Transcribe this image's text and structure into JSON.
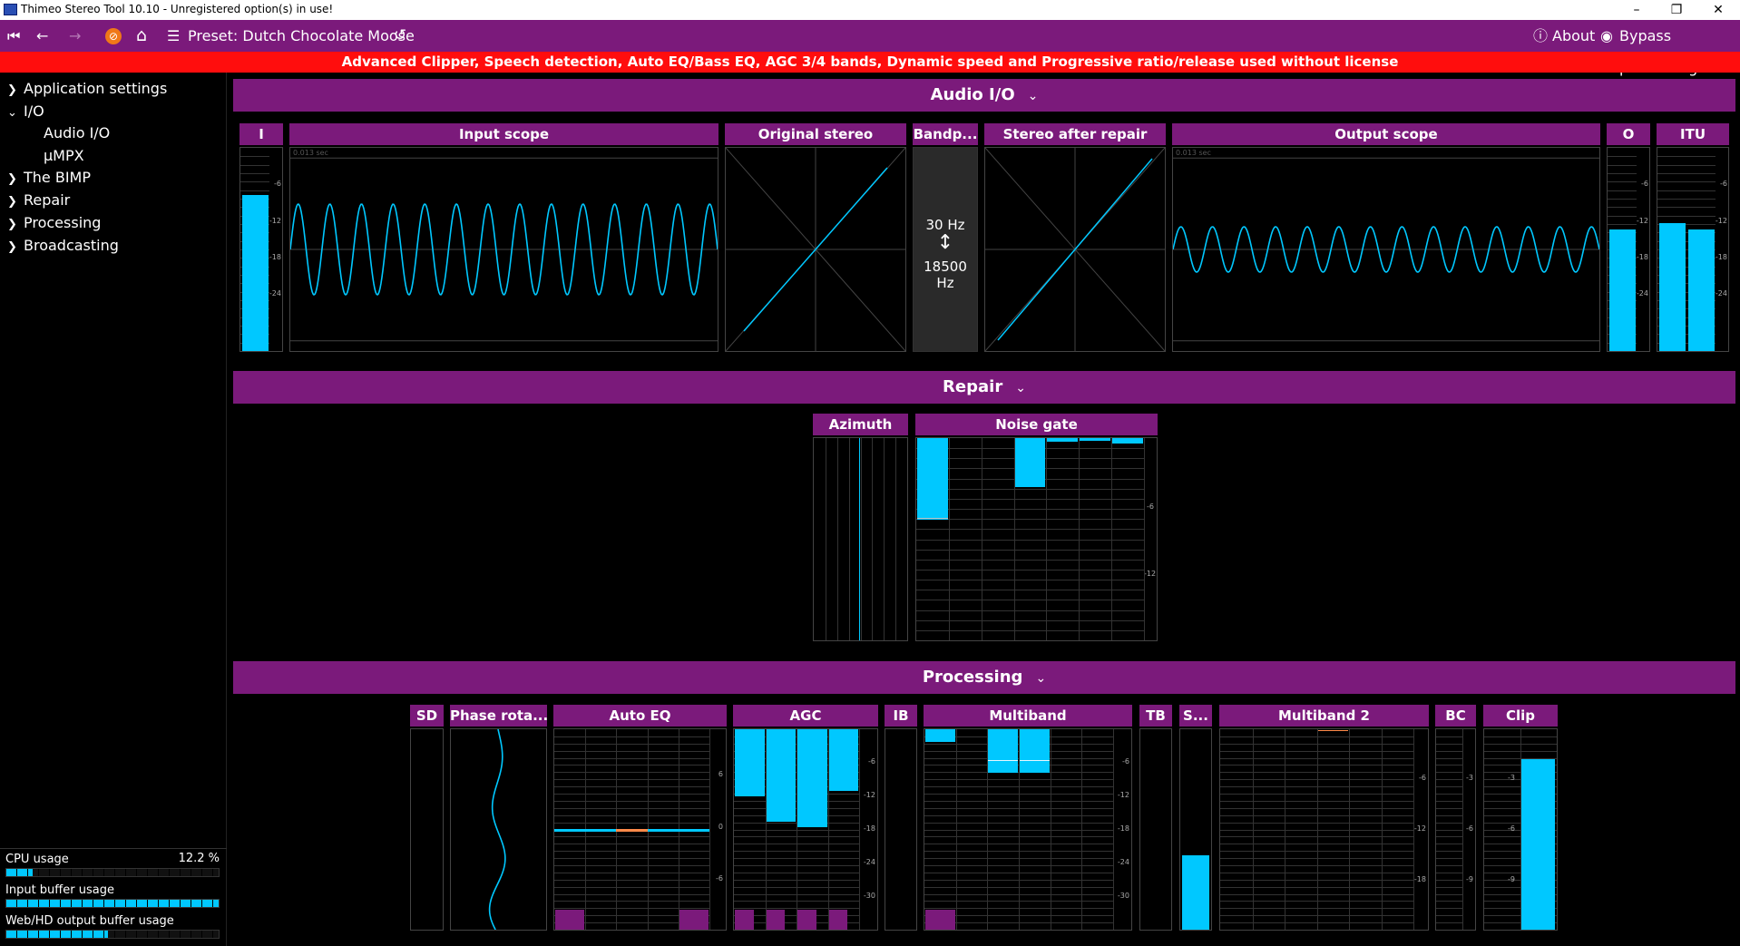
{
  "window": {
    "title": "Thimeo Stereo Tool 10.10 - Unregistered option(s) in use!",
    "minimize": "–",
    "restore": "❐",
    "close": "✕"
  },
  "toolbar": {
    "preset_label": "Preset: Dutch Chocolate Moose",
    "about_label": "About",
    "bypass_label": "Bypass processing"
  },
  "warning": {
    "text": "Advanced Clipper, Speech detection, Auto EQ/Bass EQ, AGC 3/4 bands, Dynamic speed and Progressive ratio/release used without license"
  },
  "sidebar": {
    "items": [
      {
        "label": "Application settings",
        "expanded": false
      },
      {
        "label": "I/O",
        "expanded": true
      },
      {
        "label": "Audio I/O",
        "sub": true
      },
      {
        "label": "µMPX",
        "sub": true
      },
      {
        "label": "The BIMP",
        "expanded": false
      },
      {
        "label": "Repair",
        "expanded": false
      },
      {
        "label": "Processing",
        "expanded": false
      },
      {
        "label": "Broadcasting",
        "expanded": false
      }
    ],
    "usage": {
      "cpu": {
        "label": "CPU usage",
        "value": "12.2 %",
        "fraction": 0.122
      },
      "input_buffer": {
        "label": "Input buffer usage",
        "fraction": 1.0
      },
      "output_buffer": {
        "label": "Web/HD output buffer usage",
        "fraction": 0.48
      }
    }
  },
  "sections": {
    "audio_io": "Audio I/O",
    "repair": "Repair",
    "processing": "Processing"
  },
  "audio_io": {
    "input_meter": "I",
    "input_scope": "Input scope",
    "original_stereo": "Original stereo",
    "bandpass": "Bandp...",
    "bandpass_low": "30 Hz",
    "bandpass_high": "18500 Hz",
    "stereo_after_repair": "Stereo after repair",
    "output_scope": "Output scope",
    "output_meter": "O",
    "itu_meter": "ITU",
    "scope_time": "0.013 sec",
    "meter_ticks": [
      "-6",
      "-12",
      "-18",
      "-24"
    ],
    "input_level_fraction": 0.77,
    "output_level_fraction": 0.6,
    "itu_level_fraction": [
      0.63,
      0.6
    ]
  },
  "repair": {
    "azimuth": "Azimuth",
    "noise_gate": "Noise gate",
    "noise_gate_ticks": [
      "-6",
      "-12"
    ]
  },
  "processing": {
    "sd": "SD",
    "phase_rotator": "Phase rota...",
    "auto_eq": "Auto EQ",
    "agc": "AGC",
    "ib": "IB",
    "multiband": "Multiband",
    "tb": "TB",
    "s": "S...",
    "multiband2": "Multiband 2",
    "bc": "BC",
    "clip": "Clip",
    "auto_eq_ticks": [
      "6",
      "0",
      "-6"
    ],
    "db_ticks": [
      "-6",
      "-12",
      "-18",
      "-24",
      "-30"
    ],
    "bc_ticks": [
      "-3",
      "-6",
      "-9"
    ],
    "clip_ticks": [
      "-3",
      "-6",
      "-9"
    ],
    "multiband2_ticks": [
      "-6",
      "-12",
      "-18"
    ]
  },
  "colors": {
    "purple": "#7b1a7b",
    "cyan": "#00c8ff",
    "warning_red": "#ff0d0d",
    "orange": "#f07818"
  }
}
